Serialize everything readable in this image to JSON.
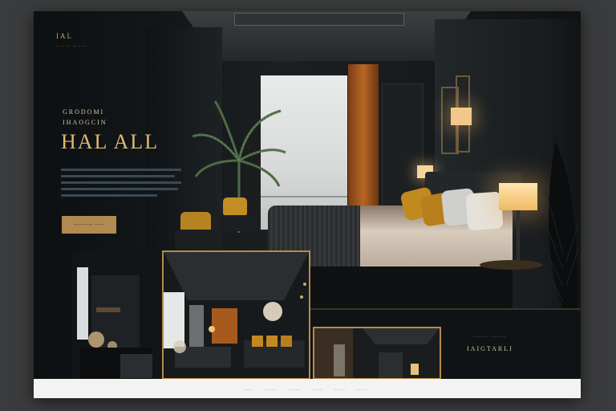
{
  "brand": {
    "mark": "IAL",
    "sub": "——— ———"
  },
  "hero": {
    "eyebrow_1": "GRODOMI",
    "eyebrow_2": "IHAOGCIN",
    "title": "HAL ALL",
    "cta_label": "———— ——"
  },
  "gallery": {
    "panel_title": "IAIGTARLI",
    "panel_sub": "———— ————"
  },
  "footer": {
    "links": [
      "——",
      "———",
      "———",
      "———",
      "———",
      "———"
    ]
  },
  "colors": {
    "accent_gold": "#e1b970",
    "background_dark": "#121416",
    "cta_fill": "#b08a4e",
    "footer_bg": "#f3f3f1"
  }
}
